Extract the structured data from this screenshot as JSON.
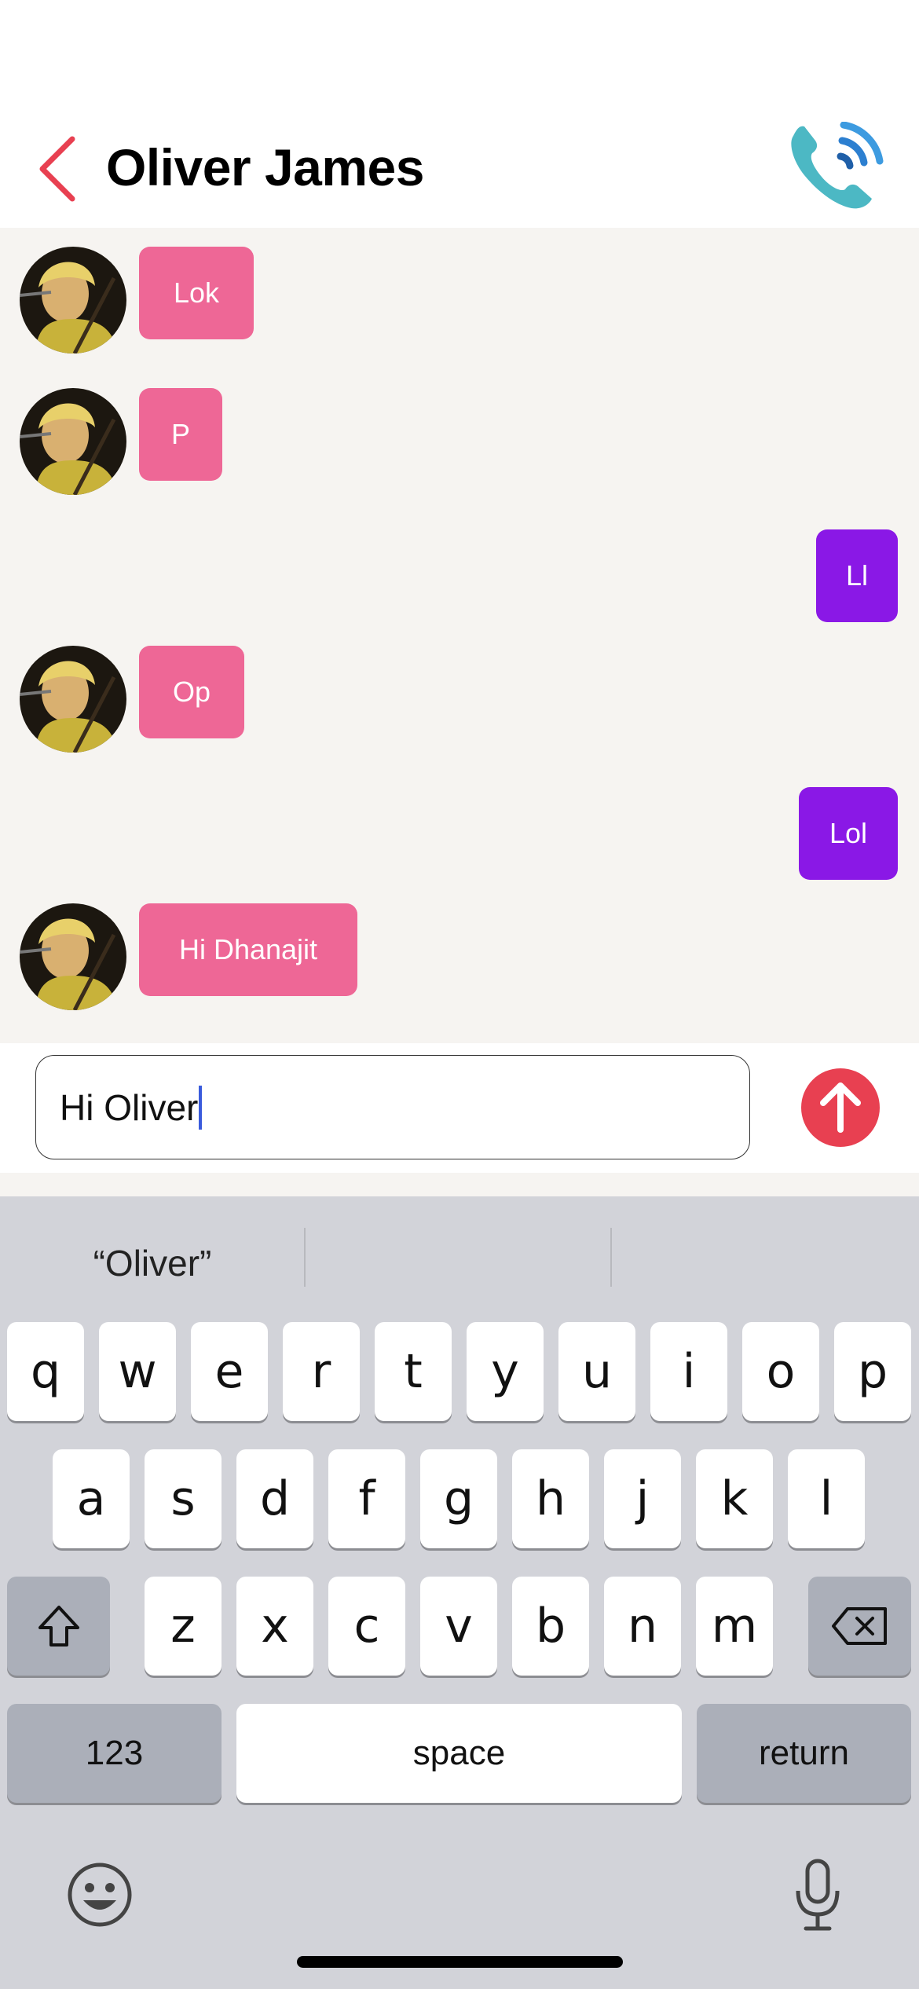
{
  "header": {
    "title": "Oliver James",
    "back_icon": "chevron-left-icon",
    "call_icon": "phone-call-icon"
  },
  "messages": [
    {
      "direction": "in",
      "text": "Lok"
    },
    {
      "direction": "in",
      "text": "P"
    },
    {
      "direction": "out",
      "text": "Ll"
    },
    {
      "direction": "in",
      "text": "Op"
    },
    {
      "direction": "out",
      "text": "Lol"
    },
    {
      "direction": "in",
      "text": "Hi Dhanajit"
    }
  ],
  "composer": {
    "value": "Hi Oliver",
    "send_icon": "arrow-up-icon"
  },
  "keyboard": {
    "suggestions": [
      "“Oliver”",
      "",
      ""
    ],
    "row1": [
      "q",
      "w",
      "e",
      "r",
      "t",
      "y",
      "u",
      "i",
      "o",
      "p"
    ],
    "row2": [
      "a",
      "s",
      "d",
      "f",
      "g",
      "h",
      "j",
      "k",
      "l"
    ],
    "row3": [
      "z",
      "x",
      "c",
      "v",
      "b",
      "n",
      "m"
    ],
    "numbers_label": "123",
    "space_label": "space",
    "return_label": "return",
    "shift_icon": "shift-icon",
    "delete_icon": "backspace-icon",
    "emoji_icon": "emoji-icon",
    "mic_icon": "microphone-icon"
  },
  "colors": {
    "incoming_bubble": "#ee6796",
    "outgoing_bubble": "#8a18e6",
    "send_button": "#e84051",
    "back_arrow": "#e84051"
  }
}
